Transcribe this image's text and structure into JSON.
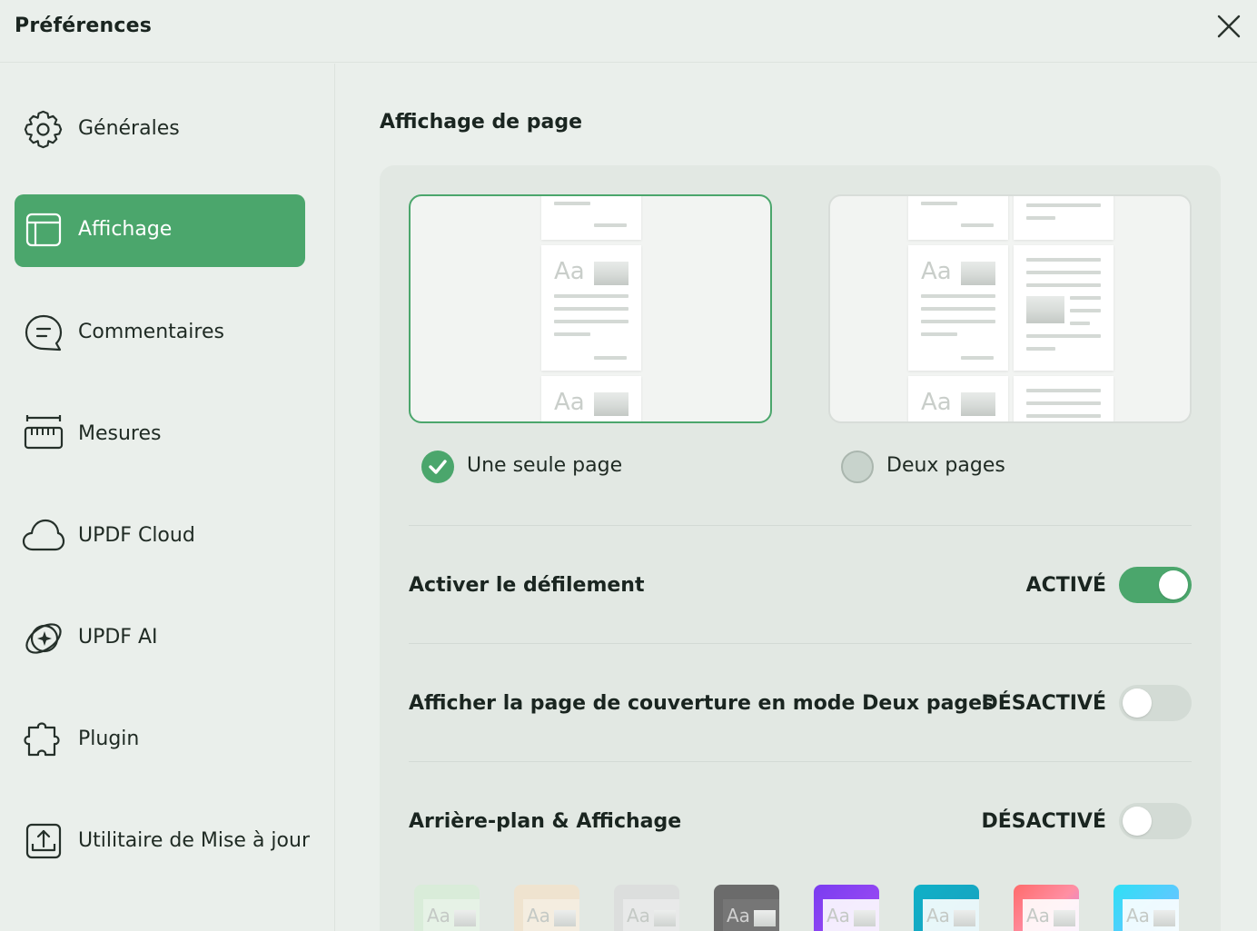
{
  "window": {
    "title": "Préférences"
  },
  "icons": {
    "close": "close-icon"
  },
  "sidebar": {
    "items": [
      {
        "label": "Générales",
        "icon": "gear-icon",
        "active": false
      },
      {
        "label": "Affichage",
        "icon": "layout-icon",
        "active": true
      },
      {
        "label": "Commentaires",
        "icon": "comment-icon",
        "active": false
      },
      {
        "label": "Mesures",
        "icon": "ruler-icon",
        "active": false
      },
      {
        "label": "UPDF Cloud",
        "icon": "cloud-icon",
        "active": false
      },
      {
        "label": "UPDF AI",
        "icon": "ai-icon",
        "active": false
      },
      {
        "label": "Plugin",
        "icon": "puzzle-icon",
        "active": false
      },
      {
        "label": "Utilitaire de Mise à jour",
        "icon": "update-icon",
        "active": false
      }
    ]
  },
  "main": {
    "section_title": "Affichage de page",
    "layout_options": [
      {
        "label": "Une seule page",
        "selected": true,
        "preview_text": "Aa"
      },
      {
        "label": "Deux pages",
        "selected": false,
        "preview_text": "Aa"
      }
    ],
    "settings": [
      {
        "label": "Activer le défilement",
        "state": "ACTIVÉ",
        "on": true
      },
      {
        "label": "Afficher la page de couverture en mode Deux pages",
        "state": "DÉSACTIVÉ",
        "on": false
      },
      {
        "label": "Arrière-plan & Affichage",
        "state": "DÉSACTIVÉ",
        "on": false
      }
    ],
    "themes": [
      {
        "sample": "Aa",
        "color": "#d9ecd9"
      },
      {
        "sample": "Aa",
        "color": "#efe3cf"
      },
      {
        "sample": "Aa",
        "color": "#dcdedd"
      },
      {
        "sample": "Aa",
        "color": "#6b6b6b"
      },
      {
        "sample": "Aa",
        "color": "#8b45f0"
      },
      {
        "sample": "Aa",
        "color": "#14a9c0"
      },
      {
        "sample": "Aa",
        "color": "#ff7a7a"
      },
      {
        "sample": "Aa",
        "color": "#3fd0f0"
      }
    ]
  },
  "colors": {
    "accent": "#4ba66c",
    "background": "#eaefeb",
    "panel": "#e2e8e3"
  }
}
